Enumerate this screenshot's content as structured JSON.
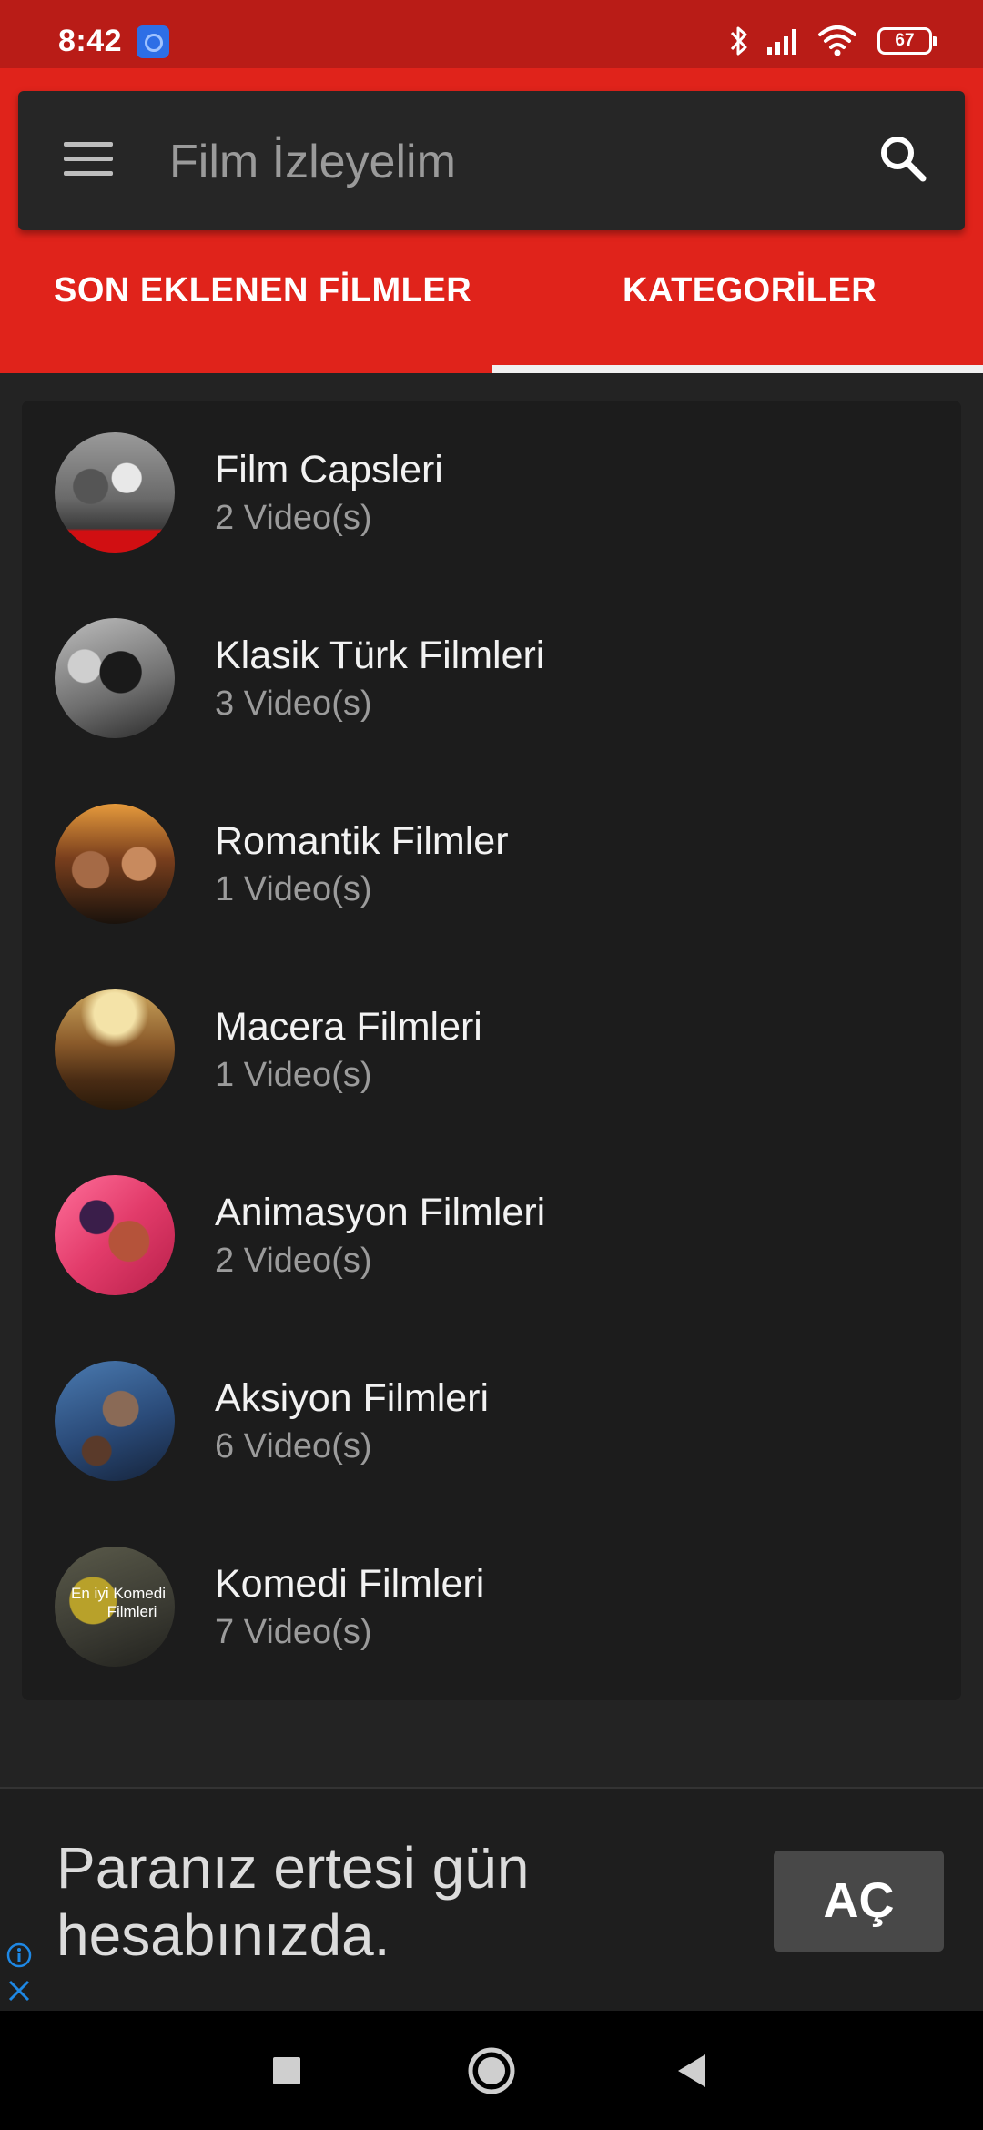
{
  "status_bar": {
    "time": "8:42",
    "battery": "67",
    "icons": [
      "bluetooth-icon",
      "signal-icon",
      "wifi-icon",
      "battery-icon"
    ]
  },
  "toolbar": {
    "title": "Film İzleyelim",
    "icons": [
      "menu-icon",
      "search-icon"
    ]
  },
  "tabs": [
    {
      "label": "SON EKLENEN FİLMLER",
      "selected": false
    },
    {
      "label": "KATEGORİLER",
      "selected": true
    }
  ],
  "categories": [
    {
      "title": "Film Capsleri",
      "count": "2 Video(s)"
    },
    {
      "title": "Klasik Türk Filmleri",
      "count": "3 Video(s)"
    },
    {
      "title": "Romantik Filmler",
      "count": "1 Video(s)"
    },
    {
      "title": "Macera Filmleri",
      "count": "1 Video(s)"
    },
    {
      "title": "Animasyon Filmleri",
      "count": "2 Video(s)"
    },
    {
      "title": "Aksiyon Filmleri",
      "count": "6 Video(s)"
    },
    {
      "title": "Komedi Filmleri",
      "count": "7 Video(s)",
      "thumb_text": [
        "En iyi Komedi",
        "Filmleri"
      ]
    }
  ],
  "ad": {
    "text": "Paranız ertesi gün hesabınızda.",
    "button": "AÇ"
  },
  "colors": {
    "header_red": "#e0231b",
    "status_red": "#b91c17",
    "background": "#232323",
    "card": "#1c1c1c"
  }
}
